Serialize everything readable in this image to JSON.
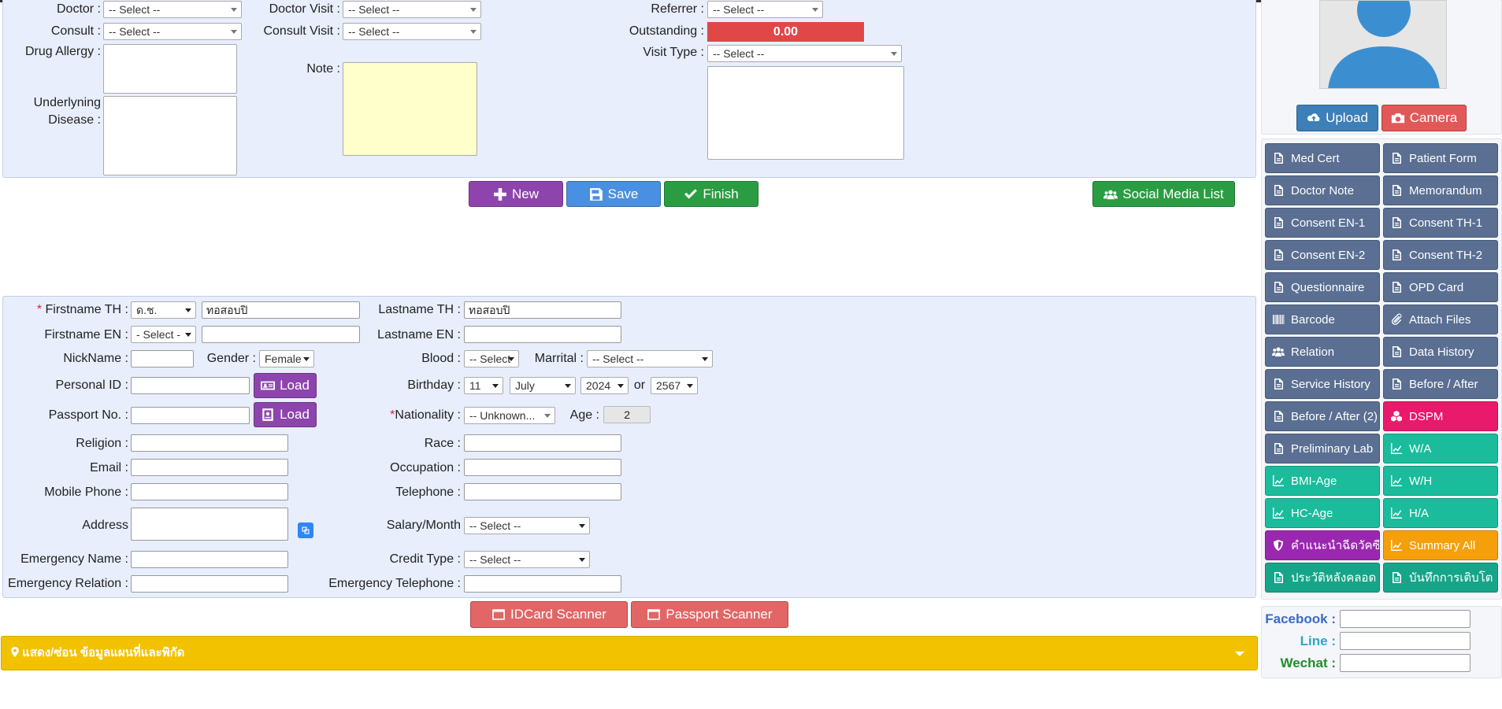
{
  "colors": {
    "panel_bg": "#e8eefc",
    "purple": "#8e44ad",
    "blue": "#4a90e2",
    "green": "#2a9d42",
    "red": "#e25858",
    "slate": "#5a6f92",
    "teal": "#1abc9c",
    "pink": "#e9196b",
    "orange": "#f5a00a",
    "violet": "#9b27b0",
    "mint": "#17a589",
    "yellow": "#f2c200",
    "outstanding": "#e04848"
  },
  "visit": {
    "doctor_label": "Doctor :",
    "doctor_value": "-- Select --",
    "consult_label": "Consult :",
    "consult_value": "-- Select --",
    "drug_allergy_label": "Drug Allergy :",
    "underlying_label_1": "Underlyning",
    "underlying_label_2": "Disease :",
    "doctor_visit_label": "Doctor Visit :",
    "doctor_visit_value": "-- Select --",
    "consult_visit_label": "Consult Visit :",
    "consult_visit_value": "-- Select --",
    "note_label": "Note :",
    "referrer_label": "Referrer :",
    "referrer_value": "-- Select --",
    "outstanding_label": "Outstanding :",
    "outstanding_value": "0.00",
    "visit_type_label": "Visit Type :",
    "visit_type_value": "-- Select --"
  },
  "actions": {
    "new_label": "New",
    "save_label": "Save",
    "finish_label": "Finish",
    "social_media_label": "Social Media List"
  },
  "patient": {
    "firstname_th_label": "Firstname TH :",
    "required_mark": "*",
    "title_th_value": "ด.ช.",
    "firstname_th_value": "ทอสอบปิ",
    "lastname_th_label": "Lastname TH :",
    "lastname_th_value": "ทอสอบปิ",
    "firstname_en_label": "Firstname EN :",
    "title_en_value": "- Select -",
    "lastname_en_label": "Lastname EN :",
    "nickname_label": "NickName :",
    "gender_label": "Gender :",
    "gender_value": "Female",
    "blood_label": "Blood :",
    "blood_value": "-- Select",
    "marital_label": "Marrital :",
    "marital_value": "-- Select --",
    "personal_id_label": "Personal ID :",
    "load_label": "Load",
    "birthday_label": "Birthday :",
    "birth_day": "11",
    "birth_month": "July",
    "birth_year": "2024",
    "or_label": "or",
    "birth_year_th": "2567",
    "passport_label": "Passport No. :",
    "nationality_label": "Nationality :",
    "nationality_value": "-- Unknown...",
    "age_label": "Age :",
    "age_value": "2",
    "religion_label": "Religion :",
    "race_label": "Race :",
    "email_label": "Email :",
    "occupation_label": "Occupation :",
    "mobile_label": "Mobile Phone :",
    "telephone_label": "Telephone :",
    "address_label": "Address",
    "salary_label": "Salary/Month",
    "salary_value": "-- Select --",
    "emergency_name_label": "Emergency Name :",
    "credit_type_label": "Credit Type :",
    "credit_type_value": "-- Select --",
    "emergency_relation_label": "Emergency Relation :",
    "emergency_tel_label": "Emergency Telephone :"
  },
  "scanners": {
    "idcard_label": "IDCard Scanner",
    "passport_label": "Passport Scanner"
  },
  "map_bar": {
    "label": "แสดง/ซ่อน ข้อมูลแผนที่และพิกัด"
  },
  "photo": {
    "upload_label": "Upload",
    "camera_label": "Camera"
  },
  "side_buttons": [
    {
      "label": "Med Cert",
      "icon": "document-icon",
      "color": "#5a6f92"
    },
    {
      "label": "Patient Form",
      "icon": "document-icon",
      "color": "#5a6f92"
    },
    {
      "label": "Doctor Note",
      "icon": "document-icon",
      "color": "#5a6f92"
    },
    {
      "label": "Memorandum",
      "icon": "document-icon",
      "color": "#5a6f92"
    },
    {
      "label": "Consent EN-1",
      "icon": "document-icon",
      "color": "#5a6f92"
    },
    {
      "label": "Consent TH-1",
      "icon": "document-icon",
      "color": "#5a6f92"
    },
    {
      "label": "Consent EN-2",
      "icon": "document-icon",
      "color": "#5a6f92"
    },
    {
      "label": "Consent TH-2",
      "icon": "document-icon",
      "color": "#5a6f92"
    },
    {
      "label": "Questionnaire",
      "icon": "document-icon",
      "color": "#5a6f92"
    },
    {
      "label": "OPD Card",
      "icon": "document-icon",
      "color": "#5a6f92"
    },
    {
      "label": "Barcode",
      "icon": "barcode-icon",
      "color": "#5a6f92"
    },
    {
      "label": "Attach Files",
      "icon": "paperclip-icon",
      "color": "#5a6f92"
    },
    {
      "label": "Relation",
      "icon": "users-icon",
      "color": "#5a6f92"
    },
    {
      "label": "Data History",
      "icon": "document-icon",
      "color": "#5a6f92"
    },
    {
      "label": "Service History",
      "icon": "document-icon",
      "color": "#5a6f92"
    },
    {
      "label": "Before / After",
      "icon": "document-icon",
      "color": "#5a6f92"
    },
    {
      "label": "Before / After (2)",
      "icon": "document-icon",
      "color": "#5a6f92"
    },
    {
      "label": "DSPM",
      "icon": "cubes-icon",
      "color": "#e9196b"
    },
    {
      "label": "Preliminary Lab",
      "icon": "document-icon",
      "color": "#5a6f92"
    },
    {
      "label": "W/A",
      "icon": "chart-line-icon",
      "color": "#1abc9c"
    },
    {
      "label": "BMI-Age",
      "icon": "chart-line-icon",
      "color": "#1abc9c"
    },
    {
      "label": "W/H",
      "icon": "chart-line-icon",
      "color": "#1abc9c"
    },
    {
      "label": "HC-Age",
      "icon": "chart-line-icon",
      "color": "#1abc9c"
    },
    {
      "label": "H/A",
      "icon": "chart-line-icon",
      "color": "#1abc9c"
    },
    {
      "label": "คำแนะนำฉีดวัคซีน",
      "icon": "shield-icon",
      "color": "#9b27b0"
    },
    {
      "label": "Summary All",
      "icon": "chart-line-icon",
      "color": "#f5a00a"
    },
    {
      "label": "ประวัติหลังคลอด",
      "icon": "document-icon",
      "color": "#17a589"
    },
    {
      "label": "บันทึกการเติบโต",
      "icon": "document-icon",
      "color": "#17a589"
    }
  ],
  "social": {
    "facebook_label": "Facebook :",
    "line_label": "Line :",
    "wechat_label": "Wechat :"
  }
}
